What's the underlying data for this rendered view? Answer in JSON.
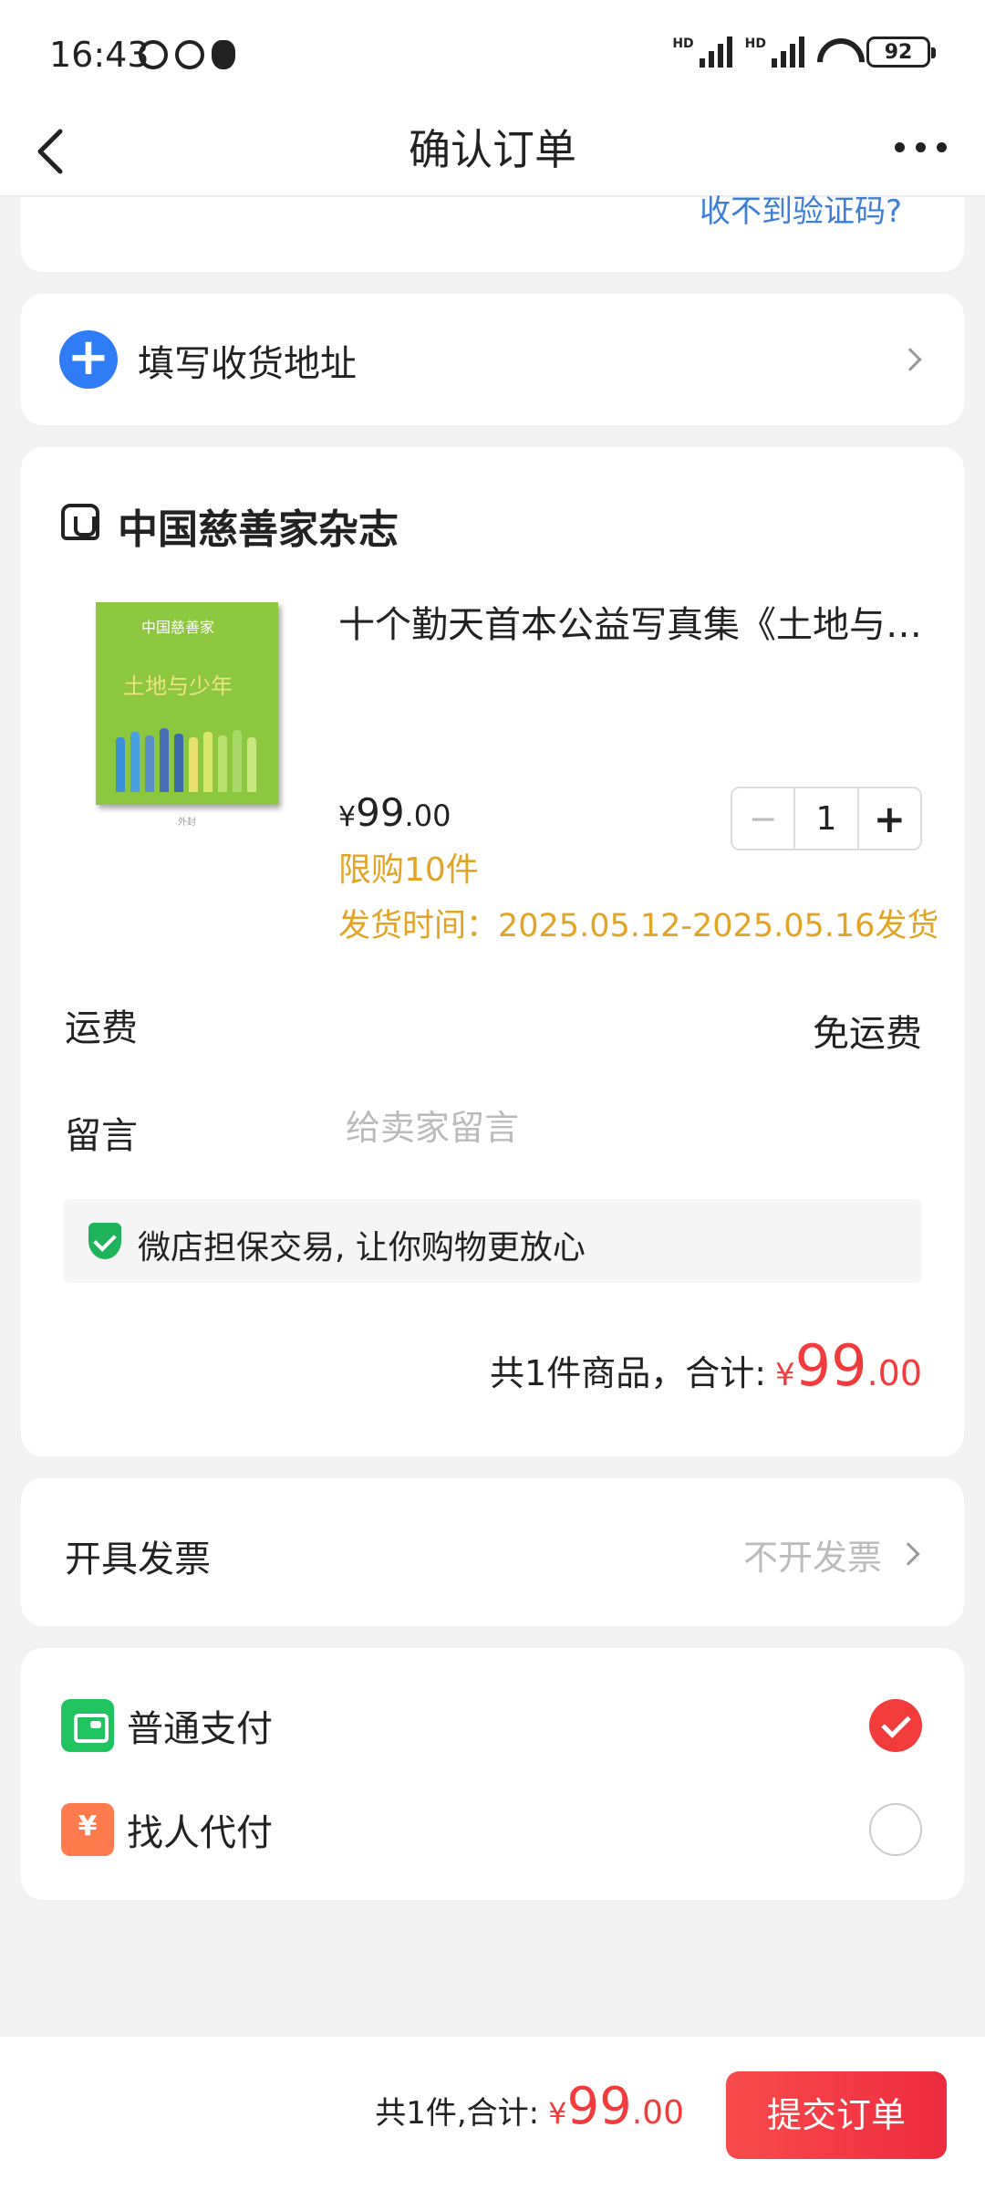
{
  "status_bar": {
    "time": "16:43",
    "battery": "92"
  },
  "nav": {
    "title": "确认订单"
  },
  "verify": {
    "link": "收不到验证码?"
  },
  "address": {
    "label": "填写收货地址"
  },
  "store": {
    "name": "中国慈善家杂志"
  },
  "product": {
    "name": "十个勤天首本公益写真集《土地与少年》",
    "cover_brand": "中国慈善家",
    "cover_title": "土地与少年",
    "image_caption": "外封",
    "price_symbol": "¥",
    "price_int": "99",
    "price_dec": ".00",
    "limit": "限购10件",
    "ship_time": "发货时间：2025.05.12-2025.05.16发货",
    "quantity": "1",
    "minus": "−",
    "plus": "+"
  },
  "freight": {
    "label": "运费",
    "value": "免运费"
  },
  "memo": {
    "label": "留言",
    "placeholder": "给卖家留言"
  },
  "guarantee": {
    "text": "微店担保交易, 让你购物更放心"
  },
  "order_total": {
    "label": "共1件商品，合计:",
    "symbol": "¥",
    "int": "99",
    "dec": ".00"
  },
  "invoice": {
    "label": "开具发票",
    "value": "不开发票"
  },
  "payment": {
    "options": [
      {
        "label": "普通支付",
        "icon": "wallet-icon",
        "selected": true
      },
      {
        "label": "找人代付",
        "icon": "hand-coin-icon",
        "selected": false
      }
    ]
  },
  "bottom": {
    "label": "共1件,合计:",
    "symbol": "¥",
    "int": "99",
    "dec": ".00",
    "submit": "提交订单"
  },
  "colors": {
    "accent_red": "#f23b3b",
    "link_blue": "#3b7fd8",
    "warning_orange": "#e5a323",
    "success_green": "#1fc35f",
    "plus_blue": "#2f7cf6"
  }
}
